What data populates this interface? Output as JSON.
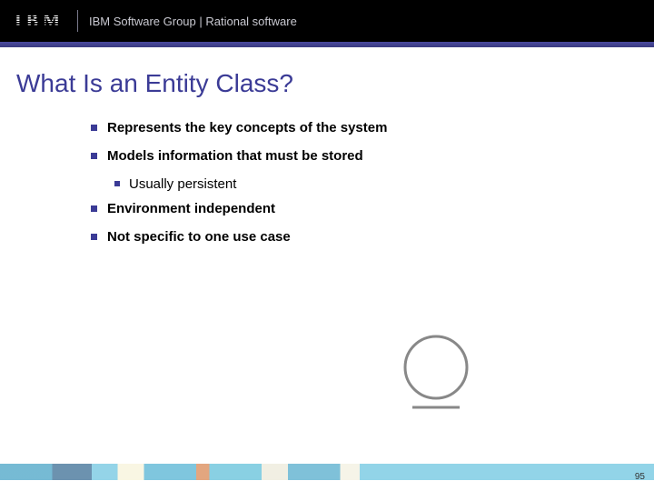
{
  "header": {
    "logo_text": "IBM",
    "subtitle": "IBM Software Group | Rational software"
  },
  "title": "What Is an Entity Class?",
  "bullets": [
    {
      "level": 1,
      "text": "Represents the key concepts of the system"
    },
    {
      "level": 1,
      "text": "Models information that must be stored"
    },
    {
      "level": 2,
      "text": "Usually persistent"
    },
    {
      "level": 1,
      "text": "Environment independent"
    },
    {
      "level": 1,
      "text": "Not specific to one use case"
    }
  ],
  "slide_number": "95"
}
